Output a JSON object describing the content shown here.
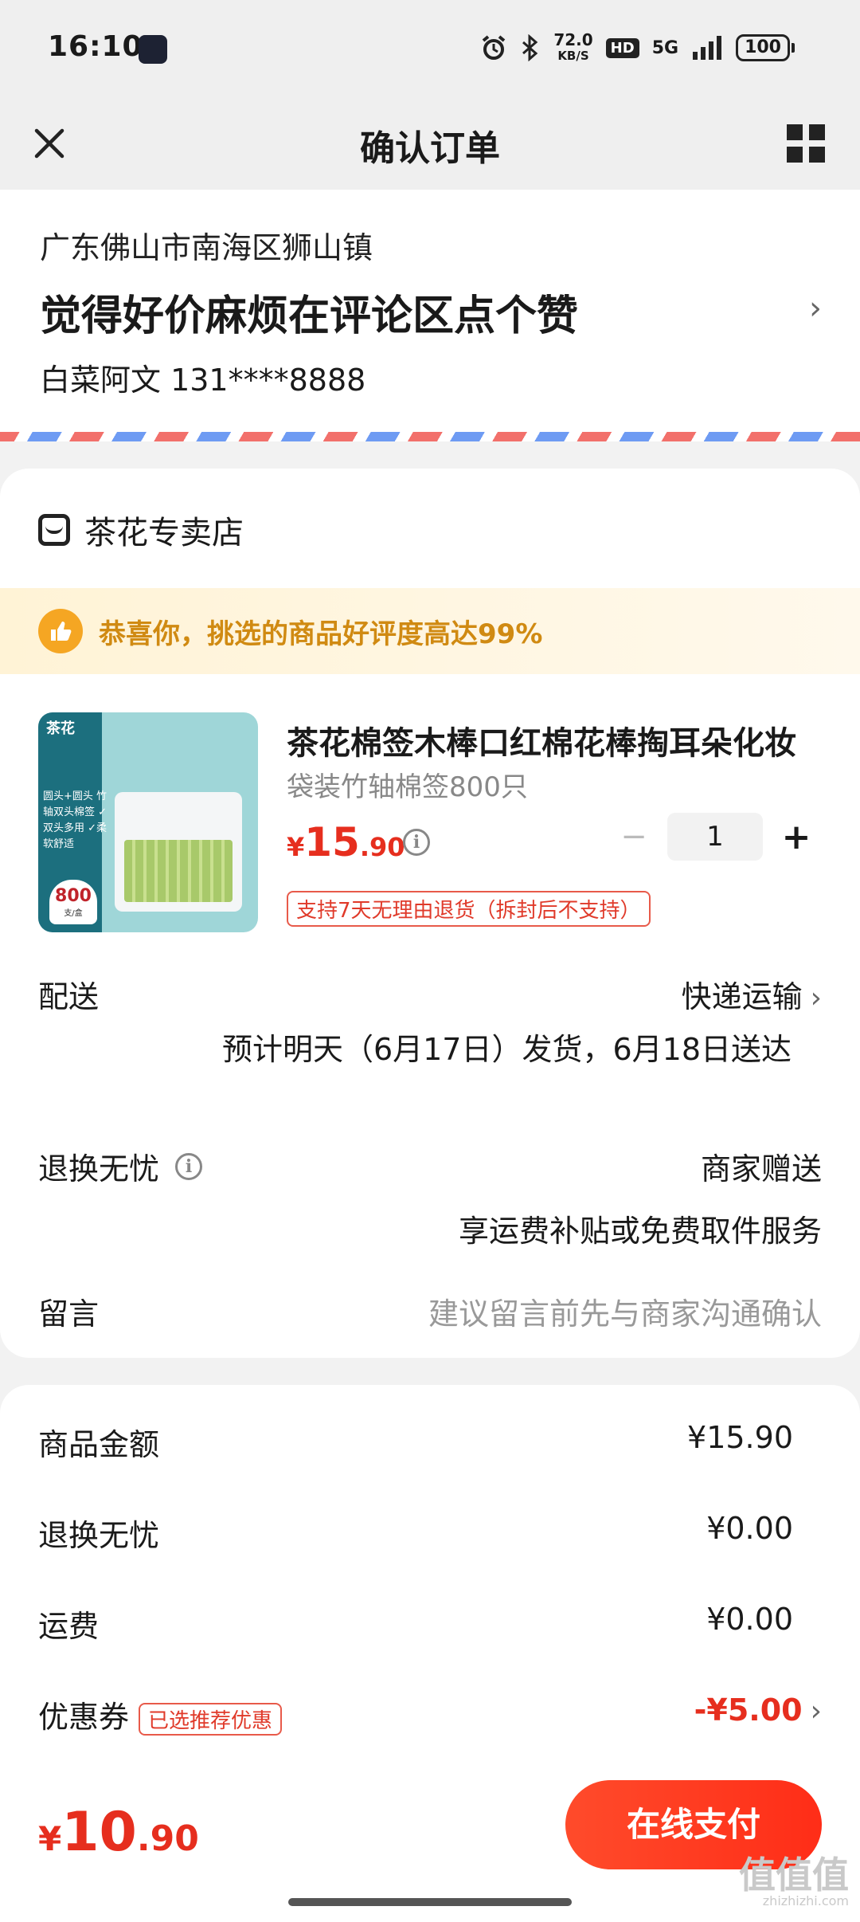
{
  "status_bar": {
    "time": "16:10",
    "speed": "72.0",
    "speed_unit": "KB/S",
    "hd": "HD",
    "network": "5G",
    "battery": "100"
  },
  "nav": {
    "title": "确认订单"
  },
  "address": {
    "region": "广东佛山市南海区狮山镇",
    "detail": "觉得好价麻烦在评论区点个赞",
    "contact": "白菜阿文 131****8888"
  },
  "store": {
    "name": "茶花专卖店"
  },
  "promo": {
    "text": "恭喜你，挑选的商品好评度高达99%"
  },
  "product": {
    "name": "茶花棉签木棒口红棉花棒掏耳朵化妆",
    "sku": "袋装竹轴棉签800只",
    "price_symbol": "¥",
    "price_int": "15",
    "price_dec": ".90",
    "quantity": "1",
    "return_tag": "支持7天无理由退货（拆封后不支持）",
    "image": {
      "brand": "茶花",
      "label_lines": "圆头+圆头 竹轴双头棉签 ✓双头多用 ✓柔软舒适",
      "count": "800",
      "count_unit": "支/盒"
    }
  },
  "delivery": {
    "label": "配送",
    "method": "快递运输",
    "estimate": "预计明天（6月17日）发货，6月18日送达"
  },
  "worry_free": {
    "label": "退换无忧",
    "value": "商家赠送",
    "sub": "享运费补贴或免费取件服务"
  },
  "message": {
    "label": "留言",
    "placeholder": "建议留言前先与商家沟通确认"
  },
  "summary": {
    "items": [
      {
        "label": "商品金额",
        "value": "¥15.90"
      },
      {
        "label": "退换无忧",
        "value": "¥0.00"
      },
      {
        "label": "运费",
        "value": "¥0.00"
      }
    ],
    "coupon": {
      "label": "优惠券",
      "tag": "已选推荐优惠",
      "value": "-¥5.00"
    }
  },
  "pay": {
    "symbol": "¥",
    "int": "10",
    "dec": ".90",
    "button": "在线支付"
  },
  "watermark": {
    "text": "值值值",
    "site": "zhizhizhi.com"
  },
  "colors": {
    "accent": "#e62e1e",
    "promo_text": "#d08a12",
    "background": "#f2f2f2"
  }
}
